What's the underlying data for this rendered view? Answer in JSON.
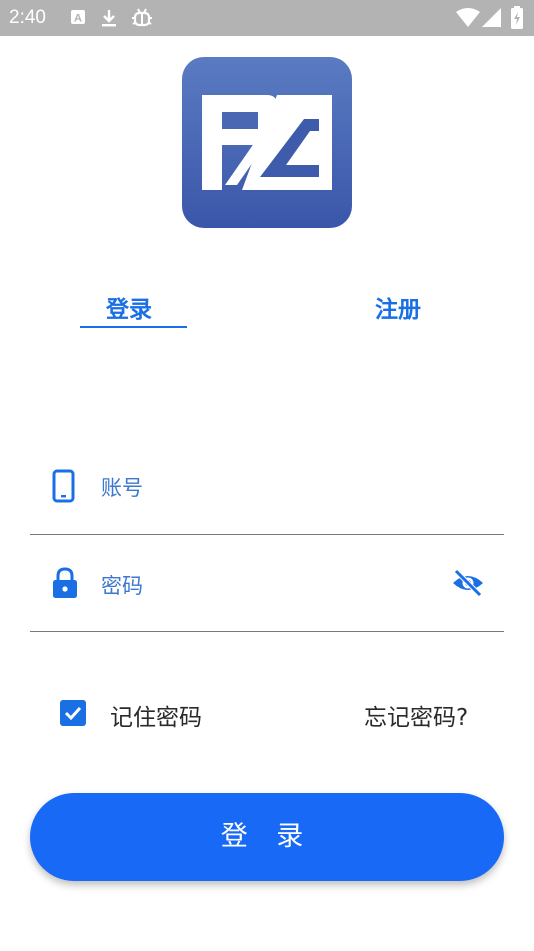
{
  "status_bar": {
    "time": "2:40",
    "icons": [
      "notification-a-icon",
      "download-icon",
      "bug-icon",
      "wifi-icon",
      "signal-icon",
      "battery-icon"
    ]
  },
  "logo": {
    "icon": "pa-logo-icon"
  },
  "tabs": [
    {
      "label": "登录",
      "active": true
    },
    {
      "label": "注册",
      "active": false
    }
  ],
  "account_field": {
    "icon": "phone-icon",
    "placeholder": "账号",
    "value": ""
  },
  "password_field": {
    "icon": "lock-icon",
    "placeholder": "密码",
    "value": "",
    "toggle_icon": "eye-off-icon"
  },
  "remember": {
    "label": "记住密码",
    "checked": true
  },
  "forgot_link": "忘记密码?",
  "login_button": "登 录",
  "colors": {
    "accent": "#1769f6",
    "tab_text": "#1a6fe5",
    "status_bar": "#b3b3b3",
    "logo_top": "#5a7bc2",
    "logo_bottom": "#3a56a9"
  }
}
